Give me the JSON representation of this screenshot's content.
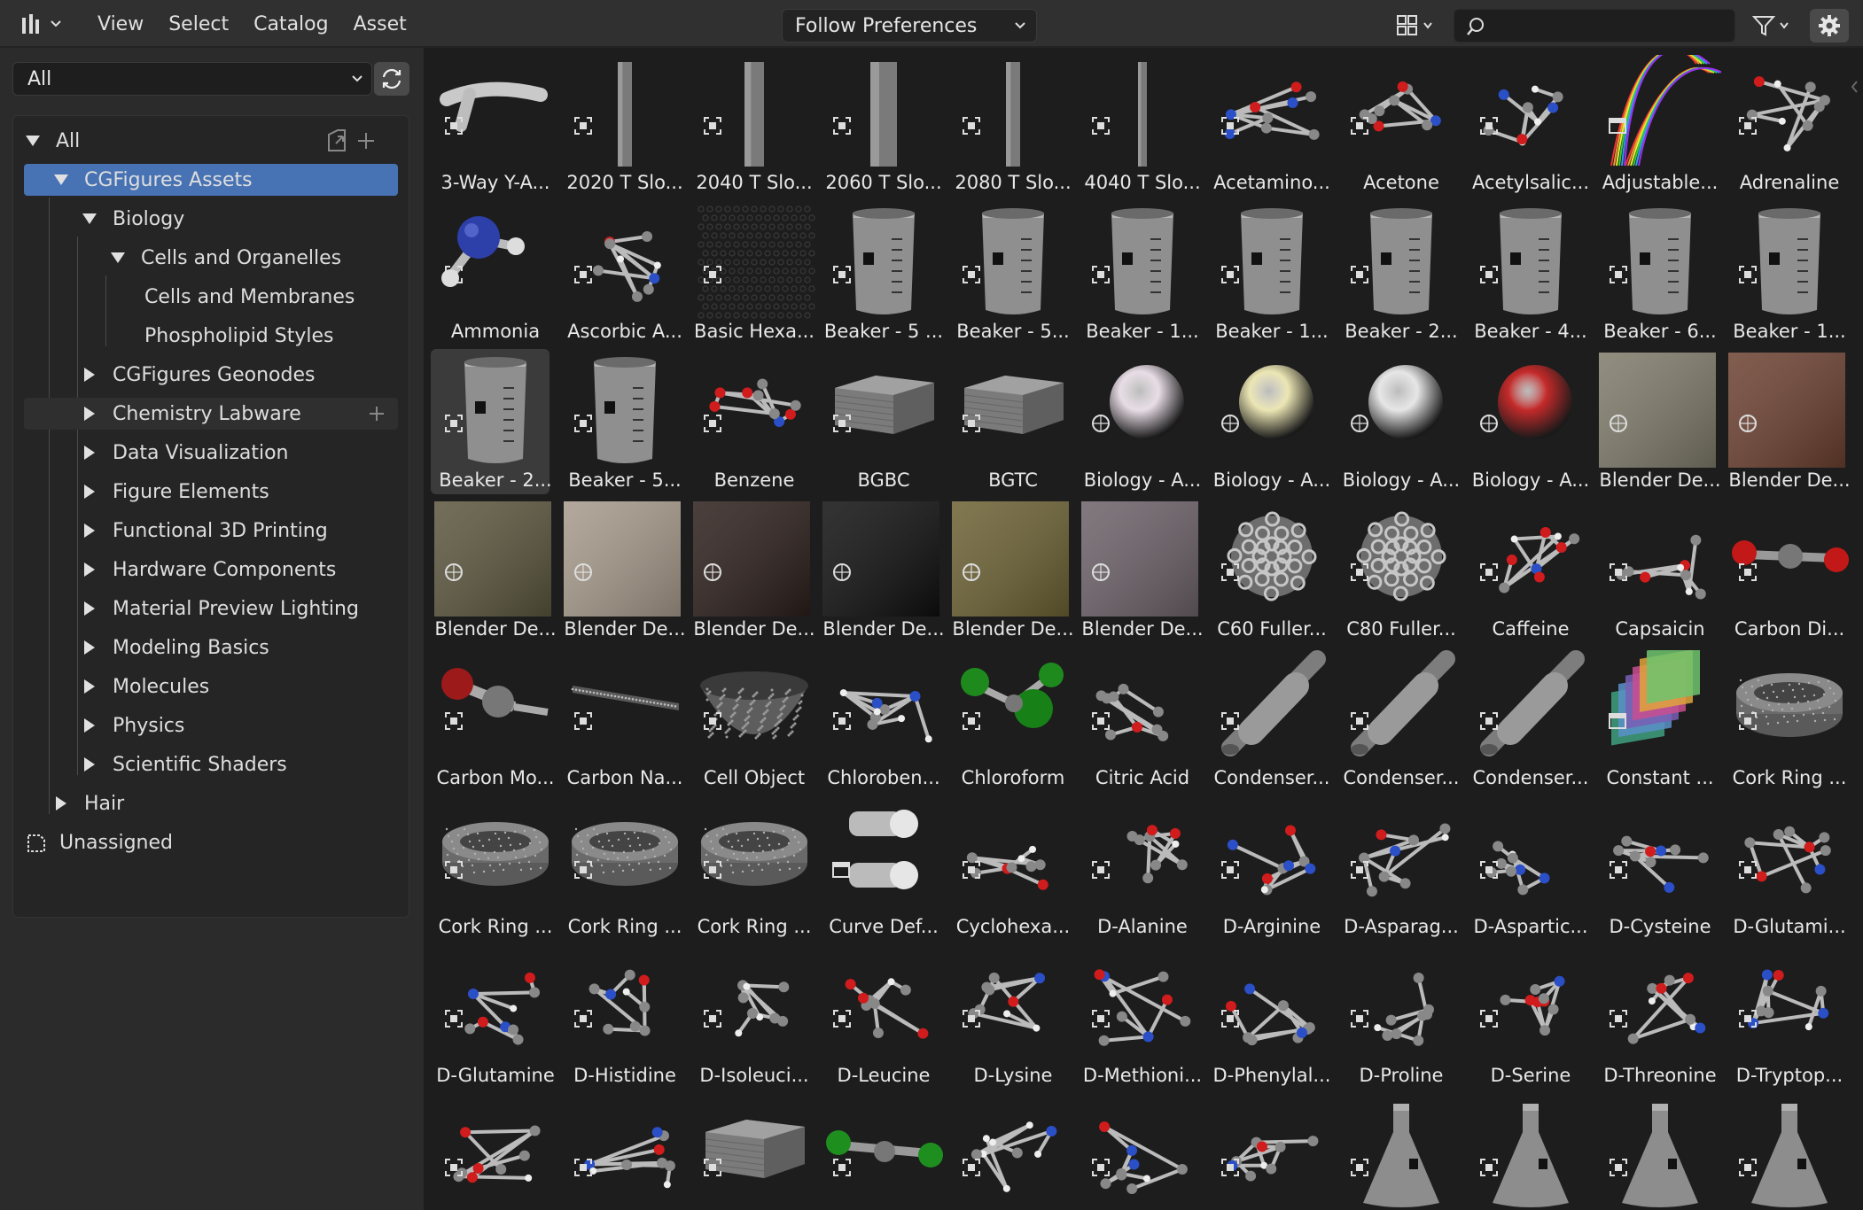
{
  "header": {
    "menus": [
      "View",
      "Select",
      "Catalog",
      "Asset"
    ],
    "import_method": "Follow Preferences",
    "search": {
      "value": "",
      "placeholder": ""
    }
  },
  "sidebar": {
    "library": "All",
    "tree": [
      {
        "label": "All",
        "level": 0,
        "state": "expanded"
      },
      {
        "label": "CGFigures Assets",
        "level": 1,
        "state": "expanded",
        "selected": true
      },
      {
        "label": "Biology",
        "level": 2,
        "state": "expanded"
      },
      {
        "label": "Cells and Organelles",
        "level": 3,
        "state": "expanded"
      },
      {
        "label": "Cells and Membranes",
        "level": 4,
        "state": "leaf"
      },
      {
        "label": "Phospholipid Styles",
        "level": 4,
        "state": "leaf"
      },
      {
        "label": "CGFigures Geonodes",
        "level": 2,
        "state": "collapsed"
      },
      {
        "label": "Chemistry Labware",
        "level": 2,
        "state": "collapsed",
        "hover": true
      },
      {
        "label": "Data Visualization",
        "level": 2,
        "state": "collapsed"
      },
      {
        "label": "Figure Elements",
        "level": 2,
        "state": "collapsed"
      },
      {
        "label": "Functional 3D Printing",
        "level": 2,
        "state": "collapsed"
      },
      {
        "label": "Hardware Components",
        "level": 2,
        "state": "collapsed"
      },
      {
        "label": "Material Preview Lighting",
        "level": 2,
        "state": "collapsed"
      },
      {
        "label": "Modeling Basics",
        "level": 2,
        "state": "collapsed"
      },
      {
        "label": "Molecules",
        "level": 2,
        "state": "collapsed"
      },
      {
        "label": "Physics",
        "level": 2,
        "state": "collapsed"
      },
      {
        "label": "Scientific Shaders",
        "level": 2,
        "state": "collapsed"
      },
      {
        "label": "Hair",
        "level": 1,
        "state": "collapsed"
      },
      {
        "label": "Unassigned",
        "level": 0,
        "state": "unassigned"
      }
    ]
  },
  "assets": [
    {
      "label": "3-Way Y-A...",
      "kind": "tube"
    },
    {
      "label": "2020 T Slo...",
      "kind": "rail"
    },
    {
      "label": "2040 T Slo...",
      "kind": "rail"
    },
    {
      "label": "2060 T Slo...",
      "kind": "rail"
    },
    {
      "label": "2080 T Slo...",
      "kind": "rail"
    },
    {
      "label": "4040 T Slo...",
      "kind": "rail"
    },
    {
      "label": "Acetamino...",
      "kind": "molecule"
    },
    {
      "label": "Acetone",
      "kind": "molecule"
    },
    {
      "label": "Acetylsalic...",
      "kind": "molecule"
    },
    {
      "label": "Adjustable...",
      "kind": "rainbow"
    },
    {
      "label": "Adrenaline",
      "kind": "molecule"
    },
    {
      "label": "Ammonia",
      "kind": "ammonia"
    },
    {
      "label": "Ascorbic A...",
      "kind": "molecule"
    },
    {
      "label": "Basic Hexa...",
      "kind": "hexgrid"
    },
    {
      "label": "Beaker - 5 ...",
      "kind": "beaker"
    },
    {
      "label": "Beaker - 5...",
      "kind": "beaker"
    },
    {
      "label": "Beaker - 1...",
      "kind": "beaker"
    },
    {
      "label": "Beaker - 1...",
      "kind": "beaker"
    },
    {
      "label": "Beaker - 2...",
      "kind": "beaker"
    },
    {
      "label": "Beaker - 4...",
      "kind": "beaker"
    },
    {
      "label": "Beaker - 6...",
      "kind": "beaker"
    },
    {
      "label": "Beaker - 1...",
      "kind": "beaker"
    },
    {
      "label": "Beaker - 2...",
      "kind": "beaker",
      "selected": true
    },
    {
      "label": "Beaker - 5...",
      "kind": "beaker"
    },
    {
      "label": "Benzene",
      "kind": "molecule"
    },
    {
      "label": "BGBC",
      "kind": "slab"
    },
    {
      "label": "BGTC",
      "kind": "slab"
    },
    {
      "label": "Biology - A...",
      "kind": "sphere",
      "color": "#e8dde6"
    },
    {
      "label": "Biology - A...",
      "kind": "sphere",
      "color": "#ece6b4"
    },
    {
      "label": "Biology - A...",
      "kind": "sphere",
      "color": "#e6e6e6"
    },
    {
      "label": "Biology - A...",
      "kind": "sphere",
      "color": "#c42a2a"
    },
    {
      "label": "Blender De...",
      "kind": "world",
      "color": "#7d7a69"
    },
    {
      "label": "Blender De...",
      "kind": "world",
      "color": "#6b4030"
    },
    {
      "label": "Blender De...",
      "kind": "world",
      "color": "#5a553d"
    },
    {
      "label": "Blender De...",
      "kind": "world",
      "color": "#a6998a"
    },
    {
      "label": "Blender De...",
      "kind": "world",
      "color": "#2b1e1a"
    },
    {
      "label": "Blender De...",
      "kind": "world",
      "color": "#0f0f10"
    },
    {
      "label": "Blender De...",
      "kind": "world",
      "color": "#6b6033"
    },
    {
      "label": "Blender De...",
      "kind": "world",
      "color": "#6b6168"
    },
    {
      "label": "C60 Fuller...",
      "kind": "fullerene"
    },
    {
      "label": "C80 Fuller...",
      "kind": "fullerene"
    },
    {
      "label": "Caffeine",
      "kind": "molecule"
    },
    {
      "label": "Capsaicin",
      "kind": "molecule"
    },
    {
      "label": "Carbon Di...",
      "kind": "co2"
    },
    {
      "label": "Carbon Mo...",
      "kind": "co"
    },
    {
      "label": "Carbon Na...",
      "kind": "nanotube"
    },
    {
      "label": "Cell Object",
      "kind": "bowl"
    },
    {
      "label": "Chloroben...",
      "kind": "molecule"
    },
    {
      "label": "Chloroform",
      "kind": "chloroform"
    },
    {
      "label": "Citric Acid",
      "kind": "molecule"
    },
    {
      "label": "Condenser...",
      "kind": "condenser"
    },
    {
      "label": "Condenser...",
      "kind": "condenser"
    },
    {
      "label": "Condenser...",
      "kind": "condenser"
    },
    {
      "label": "Constant ...",
      "kind": "cards"
    },
    {
      "label": "Cork Ring ...",
      "kind": "cork"
    },
    {
      "label": "Cork Ring ...",
      "kind": "cork"
    },
    {
      "label": "Cork Ring ...",
      "kind": "cork"
    },
    {
      "label": "Cork Ring ...",
      "kind": "cork"
    },
    {
      "label": "Curve Def...",
      "kind": "curve"
    },
    {
      "label": "Cyclohexa...",
      "kind": "molecule"
    },
    {
      "label": "D-Alanine",
      "kind": "molecule"
    },
    {
      "label": "D-Arginine",
      "kind": "molecule"
    },
    {
      "label": "D-Asparag...",
      "kind": "molecule"
    },
    {
      "label": "D-Aspartic...",
      "kind": "molecule"
    },
    {
      "label": "D-Cysteine",
      "kind": "molecule"
    },
    {
      "label": "D-Glutami...",
      "kind": "molecule"
    },
    {
      "label": "D-Glutamine",
      "kind": "molecule"
    },
    {
      "label": "D-Histidine",
      "kind": "molecule"
    },
    {
      "label": "D-Isoleuci...",
      "kind": "molecule"
    },
    {
      "label": "D-Leucine",
      "kind": "molecule"
    },
    {
      "label": "D-Lysine",
      "kind": "molecule"
    },
    {
      "label": "D-Methioni...",
      "kind": "molecule"
    },
    {
      "label": "D-Phenylal...",
      "kind": "molecule"
    },
    {
      "label": "D-Proline",
      "kind": "molecule"
    },
    {
      "label": "D-Serine",
      "kind": "molecule"
    },
    {
      "label": "D-Threonine",
      "kind": "molecule"
    },
    {
      "label": "D-Tryptop...",
      "kind": "molecule"
    },
    {
      "label": "",
      "kind": "molecule"
    },
    {
      "label": "",
      "kind": "molecule"
    },
    {
      "label": "",
      "kind": "slab"
    },
    {
      "label": "",
      "kind": "co2green"
    },
    {
      "label": "",
      "kind": "molecule"
    },
    {
      "label": "",
      "kind": "molecule"
    },
    {
      "label": "",
      "kind": "molecule"
    },
    {
      "label": "",
      "kind": "flask"
    },
    {
      "label": "",
      "kind": "flask"
    },
    {
      "label": "",
      "kind": "flask"
    },
    {
      "label": "",
      "kind": "flask"
    }
  ],
  "colors": {
    "selection": "#4772b3",
    "header_bg": "#303030",
    "sidebar_bg": "#2b2b2b",
    "grid_bg": "#1d1d1d"
  }
}
